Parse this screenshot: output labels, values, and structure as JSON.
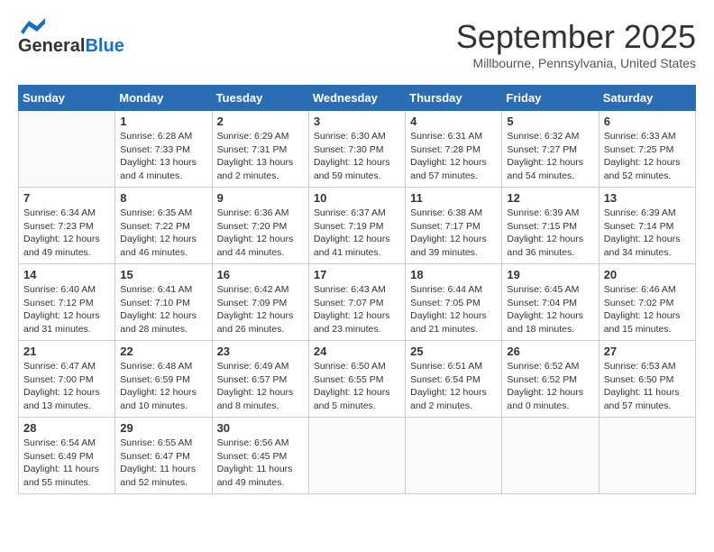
{
  "header": {
    "logo_general": "General",
    "logo_blue": "Blue",
    "month_title": "September 2025",
    "location": "Millbourne, Pennsylvania, United States"
  },
  "weekdays": [
    "Sunday",
    "Monday",
    "Tuesday",
    "Wednesday",
    "Thursday",
    "Friday",
    "Saturday"
  ],
  "weeks": [
    [
      {
        "day": "",
        "info": ""
      },
      {
        "day": "1",
        "info": "Sunrise: 6:28 AM\nSunset: 7:33 PM\nDaylight: 13 hours\nand 4 minutes."
      },
      {
        "day": "2",
        "info": "Sunrise: 6:29 AM\nSunset: 7:31 PM\nDaylight: 13 hours\nand 2 minutes."
      },
      {
        "day": "3",
        "info": "Sunrise: 6:30 AM\nSunset: 7:30 PM\nDaylight: 12 hours\nand 59 minutes."
      },
      {
        "day": "4",
        "info": "Sunrise: 6:31 AM\nSunset: 7:28 PM\nDaylight: 12 hours\nand 57 minutes."
      },
      {
        "day": "5",
        "info": "Sunrise: 6:32 AM\nSunset: 7:27 PM\nDaylight: 12 hours\nand 54 minutes."
      },
      {
        "day": "6",
        "info": "Sunrise: 6:33 AM\nSunset: 7:25 PM\nDaylight: 12 hours\nand 52 minutes."
      }
    ],
    [
      {
        "day": "7",
        "info": "Sunrise: 6:34 AM\nSunset: 7:23 PM\nDaylight: 12 hours\nand 49 minutes."
      },
      {
        "day": "8",
        "info": "Sunrise: 6:35 AM\nSunset: 7:22 PM\nDaylight: 12 hours\nand 46 minutes."
      },
      {
        "day": "9",
        "info": "Sunrise: 6:36 AM\nSunset: 7:20 PM\nDaylight: 12 hours\nand 44 minutes."
      },
      {
        "day": "10",
        "info": "Sunrise: 6:37 AM\nSunset: 7:19 PM\nDaylight: 12 hours\nand 41 minutes."
      },
      {
        "day": "11",
        "info": "Sunrise: 6:38 AM\nSunset: 7:17 PM\nDaylight: 12 hours\nand 39 minutes."
      },
      {
        "day": "12",
        "info": "Sunrise: 6:39 AM\nSunset: 7:15 PM\nDaylight: 12 hours\nand 36 minutes."
      },
      {
        "day": "13",
        "info": "Sunrise: 6:39 AM\nSunset: 7:14 PM\nDaylight: 12 hours\nand 34 minutes."
      }
    ],
    [
      {
        "day": "14",
        "info": "Sunrise: 6:40 AM\nSunset: 7:12 PM\nDaylight: 12 hours\nand 31 minutes."
      },
      {
        "day": "15",
        "info": "Sunrise: 6:41 AM\nSunset: 7:10 PM\nDaylight: 12 hours\nand 28 minutes."
      },
      {
        "day": "16",
        "info": "Sunrise: 6:42 AM\nSunset: 7:09 PM\nDaylight: 12 hours\nand 26 minutes."
      },
      {
        "day": "17",
        "info": "Sunrise: 6:43 AM\nSunset: 7:07 PM\nDaylight: 12 hours\nand 23 minutes."
      },
      {
        "day": "18",
        "info": "Sunrise: 6:44 AM\nSunset: 7:05 PM\nDaylight: 12 hours\nand 21 minutes."
      },
      {
        "day": "19",
        "info": "Sunrise: 6:45 AM\nSunset: 7:04 PM\nDaylight: 12 hours\nand 18 minutes."
      },
      {
        "day": "20",
        "info": "Sunrise: 6:46 AM\nSunset: 7:02 PM\nDaylight: 12 hours\nand 15 minutes."
      }
    ],
    [
      {
        "day": "21",
        "info": "Sunrise: 6:47 AM\nSunset: 7:00 PM\nDaylight: 12 hours\nand 13 minutes."
      },
      {
        "day": "22",
        "info": "Sunrise: 6:48 AM\nSunset: 6:59 PM\nDaylight: 12 hours\nand 10 minutes."
      },
      {
        "day": "23",
        "info": "Sunrise: 6:49 AM\nSunset: 6:57 PM\nDaylight: 12 hours\nand 8 minutes."
      },
      {
        "day": "24",
        "info": "Sunrise: 6:50 AM\nSunset: 6:55 PM\nDaylight: 12 hours\nand 5 minutes."
      },
      {
        "day": "25",
        "info": "Sunrise: 6:51 AM\nSunset: 6:54 PM\nDaylight: 12 hours\nand 2 minutes."
      },
      {
        "day": "26",
        "info": "Sunrise: 6:52 AM\nSunset: 6:52 PM\nDaylight: 12 hours\nand 0 minutes."
      },
      {
        "day": "27",
        "info": "Sunrise: 6:53 AM\nSunset: 6:50 PM\nDaylight: 11 hours\nand 57 minutes."
      }
    ],
    [
      {
        "day": "28",
        "info": "Sunrise: 6:54 AM\nSunset: 6:49 PM\nDaylight: 11 hours\nand 55 minutes."
      },
      {
        "day": "29",
        "info": "Sunrise: 6:55 AM\nSunset: 6:47 PM\nDaylight: 11 hours\nand 52 minutes."
      },
      {
        "day": "30",
        "info": "Sunrise: 6:56 AM\nSunset: 6:45 PM\nDaylight: 11 hours\nand 49 minutes."
      },
      {
        "day": "",
        "info": ""
      },
      {
        "day": "",
        "info": ""
      },
      {
        "day": "",
        "info": ""
      },
      {
        "day": "",
        "info": ""
      }
    ]
  ]
}
